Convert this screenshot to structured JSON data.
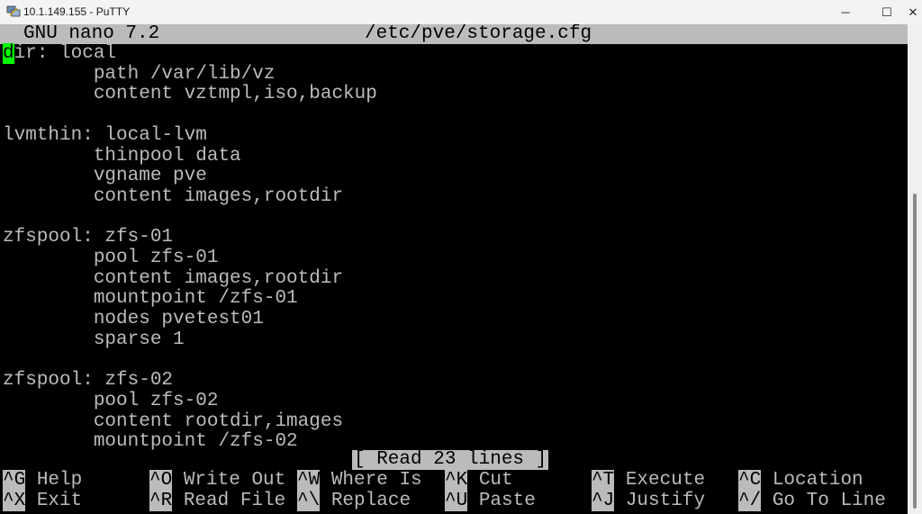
{
  "window": {
    "title": "10.1.149.155 - PuTTY",
    "app_icon": "putty-icon",
    "controls": {
      "minimize": "─",
      "maximize": "☐",
      "close": "✕"
    }
  },
  "nano": {
    "version_label": "GNU nano 7.2",
    "filename": "/etc/pve/storage.cfg",
    "cursor_char": "d",
    "first_line_rest": "ir: local",
    "lines": [
      "        path /var/lib/vz",
      "        content vztmpl,iso,backup",
      "",
      "lvmthin: local-lvm",
      "        thinpool data",
      "        vgname pve",
      "        content images,rootdir",
      "",
      "zfspool: zfs-01",
      "        pool zfs-01",
      "        content images,rootdir",
      "        mountpoint /zfs-01",
      "        nodes pvetest01",
      "        sparse 1",
      "",
      "zfspool: zfs-02",
      "        pool zfs-02",
      "        content rootdir,images",
      "        mountpoint /zfs-02"
    ],
    "status_message": "[ Read 23 lines ]",
    "shortcuts": [
      {
        "key": "^G",
        "label": "Help"
      },
      {
        "key": "^O",
        "label": "Write Out"
      },
      {
        "key": "^W",
        "label": "Where Is"
      },
      {
        "key": "^K",
        "label": "Cut"
      },
      {
        "key": "^T",
        "label": "Execute"
      },
      {
        "key": "^C",
        "label": "Location"
      },
      {
        "key": "^X",
        "label": "Exit"
      },
      {
        "key": "^R",
        "label": "Read File"
      },
      {
        "key": "^\\",
        "label": "Replace"
      },
      {
        "key": "^U",
        "label": "Paste"
      },
      {
        "key": "^J",
        "label": "Justify"
      },
      {
        "key": "^/",
        "label": "Go To Line"
      }
    ]
  }
}
